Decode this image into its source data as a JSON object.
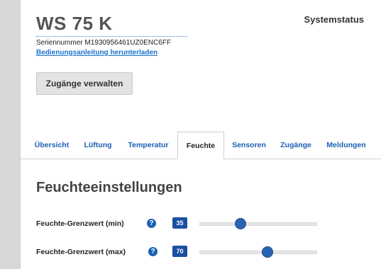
{
  "header": {
    "device_name": "WS 75 K",
    "serial_number": "Seriennummer M1930956461UZ0ENC6FF",
    "manual_link": "Bedienungsanleitung herunterladen",
    "system_status": "Systemstatus",
    "access_button": "Zugänge verwalten"
  },
  "tabs": [
    {
      "label": "Übersicht",
      "active": false
    },
    {
      "label": "Lüftung",
      "active": false
    },
    {
      "label": "Temperatur",
      "active": false
    },
    {
      "label": "Feuchte",
      "active": true
    },
    {
      "label": "Sensoren",
      "active": false
    },
    {
      "label": "Zugänge",
      "active": false
    },
    {
      "label": "Meldungen",
      "active": false
    }
  ],
  "section": {
    "title": "Feuchteeinstellungen",
    "settings": [
      {
        "label": "Feuchte-Grenzwert (min)",
        "value": "35",
        "help_icon": "?",
        "slider_fraction": 0.35
      },
      {
        "label": "Feuchte-Grenzwert (max)",
        "value": "70",
        "help_icon": "?",
        "slider_fraction": 0.58
      }
    ]
  },
  "colors": {
    "accent": "#1a5fb4",
    "badge": "#1a4fa0",
    "link": "#1a73c9"
  },
  "icons": [
    "help-icon"
  ]
}
